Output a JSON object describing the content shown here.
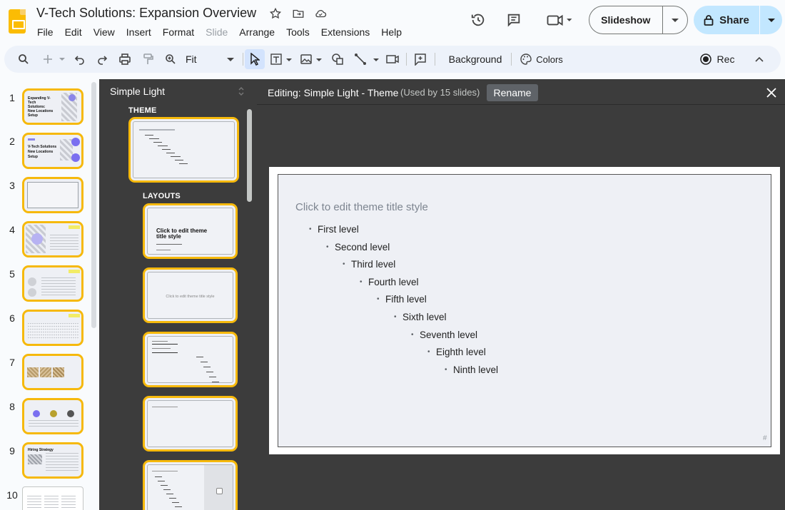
{
  "app": {
    "doc_title": "V-Tech Solutions: Expansion Overview",
    "menu": [
      "File",
      "Edit",
      "View",
      "Insert",
      "Format",
      "Slide",
      "Arrange",
      "Tools",
      "Extensions",
      "Help"
    ],
    "disabled_menu": "Slide",
    "slideshow_label": "Slideshow",
    "share_label": "Share"
  },
  "toolbar": {
    "zoom_label": "Fit",
    "background_label": "Background",
    "colors_label": "Colors",
    "rec_label": "Rec"
  },
  "filmstrip": {
    "slides": [
      {
        "num": "1",
        "title": "Expanding V-Tech Solutions: New Locations Setup"
      },
      {
        "num": "2",
        "title": "V-Tech Solutions New Locations Setup"
      },
      {
        "num": "3",
        "title": ""
      },
      {
        "num": "4",
        "title": ""
      },
      {
        "num": "5",
        "title": ""
      },
      {
        "num": "6",
        "title": ""
      },
      {
        "num": "7",
        "title": ""
      },
      {
        "num": "8",
        "title": ""
      },
      {
        "num": "9",
        "title": "Hiring Strategy"
      },
      {
        "num": "10",
        "title": ""
      }
    ]
  },
  "theme_panel": {
    "theme_name": "Simple Light",
    "theme_section": "THEME",
    "layouts_section": "LAYOUTS",
    "layout_title_text": "Click to edit theme title style"
  },
  "editor": {
    "editing_label": "Editing: Simple Light - Theme",
    "used_label": "(Used by 15 slides)",
    "rename_label": "Rename",
    "slide_title": "Click to edit theme title style",
    "levels": [
      "First level",
      "Second level",
      "Third level",
      "Fourth level",
      "Fifth level",
      "Sixth level",
      "Seventh level",
      "Eighth level",
      "Ninth level"
    ],
    "slide_number": "#"
  },
  "colors": {
    "accent_selection": "#f6b90c",
    "share_bg": "#c2e7ff",
    "panel_bg": "#3c3c3c",
    "toolbar_bg": "#edf2fa"
  }
}
